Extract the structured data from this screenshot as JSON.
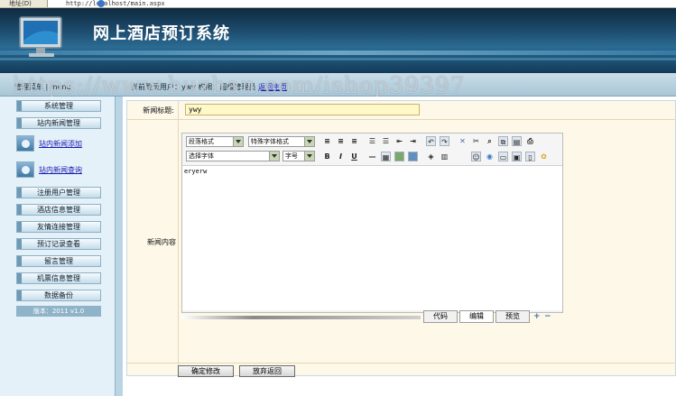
{
  "browser": {
    "address_label": "地址(D)",
    "url": "http://localhost/main.aspx"
  },
  "header": {
    "title": "网上酒店预订系统"
  },
  "infobar": {
    "left_text": "管理菜单 | menu",
    "mid_text": "当前登录用户：ywy  权限：超级管理员",
    "return_link": "返回主页"
  },
  "watermark": "https://www.huzhan.com/ishop39397",
  "sidebar": {
    "items_top": [
      {
        "label": "系统管理"
      },
      {
        "label": "站内新闻管理"
      }
    ],
    "links": [
      {
        "label": "站内新闻添加",
        "icon": "document-add-icon"
      },
      {
        "label": "站内新闻查询",
        "icon": "search-gear-icon"
      }
    ],
    "items_bottom": [
      {
        "label": "注册用户管理"
      },
      {
        "label": "酒店信息管理"
      },
      {
        "label": "友情连接管理"
      },
      {
        "label": "预订记录查看"
      },
      {
        "label": "留言管理"
      },
      {
        "label": "机票信息管理"
      },
      {
        "label": "数据备份"
      }
    ],
    "version": "版本：2011 v1.0"
  },
  "form": {
    "title_label": "新闻标题:",
    "title_value": "ywy",
    "content_label": "新闻内容",
    "editor": {
      "select_paragraph": "段落格式",
      "select_special": "特殊字体格式",
      "select_font": "选择字体",
      "select_size": "字号",
      "content": "eryerw",
      "tabs": [
        "代码",
        "编辑",
        "预览"
      ]
    },
    "confirm_button": "确定修改",
    "cancel_button": "放弃返回"
  },
  "colors": {
    "banner": "#1d4c6e",
    "link": "#1a1ab4",
    "form_bg": "#fdf8e8",
    "input_bg": "#fff8c8"
  }
}
